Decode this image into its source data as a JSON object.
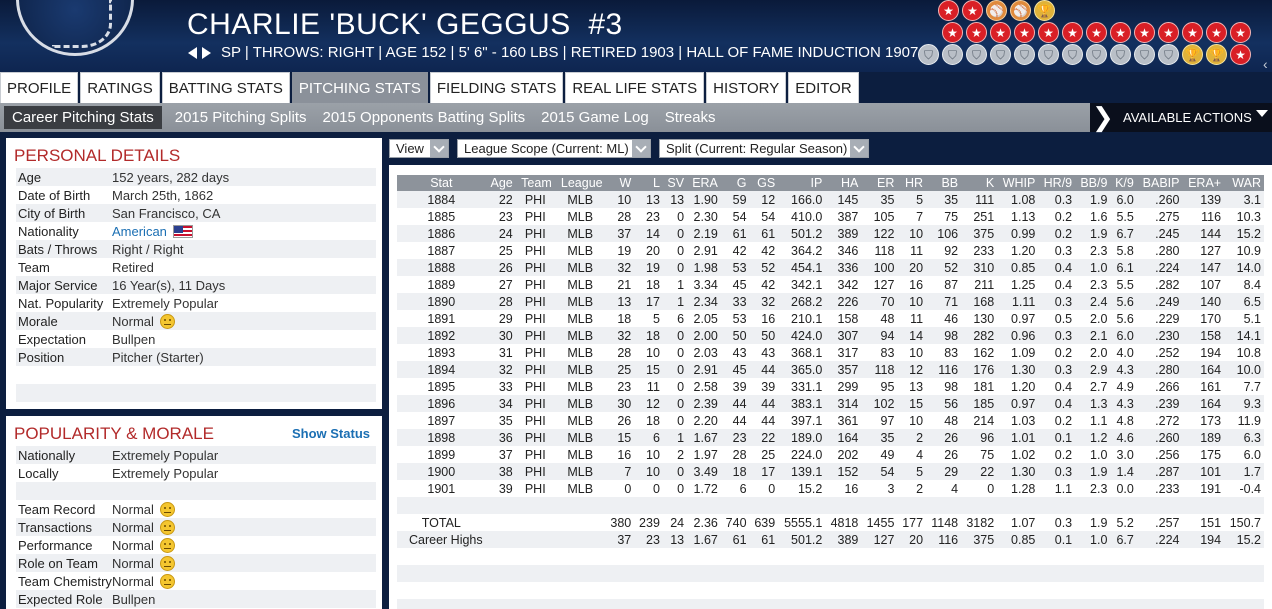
{
  "header": {
    "name": "CHARLIE 'BUCK' GEGGUS",
    "number": "#3",
    "info": "SP | THROWS: RIGHT  |  AGE 152  |  5' 6\" - 160 LBS  |  RETIRED 1903  |  HALL OF FAME INDUCTION 1907  |",
    "awards_row1": [
      "star",
      "star",
      "ball",
      "ball",
      "gold"
    ],
    "awards_row2": [
      "star",
      "star",
      "star",
      "star",
      "star",
      "star",
      "star",
      "star",
      "star",
      "star",
      "star",
      "star",
      "star"
    ],
    "awards_row3": [
      "silver",
      "silver",
      "silver",
      "silver",
      "silver",
      "silver",
      "silver",
      "silver",
      "silver",
      "silver",
      "silver",
      "gold",
      "gold",
      "star"
    ]
  },
  "tabs": [
    "PROFILE",
    "RATINGS",
    "BATTING STATS",
    "PITCHING STATS",
    "FIELDING STATS",
    "REAL LIFE STATS",
    "HISTORY",
    "EDITOR"
  ],
  "active_tab": "PITCHING STATS",
  "subtabs": [
    "Career Pitching Stats",
    "2015 Pitching Splits",
    "2015 Opponents Batting Splits",
    "2015 Game Log",
    "Streaks"
  ],
  "actions_label": "AVAILABLE ACTIONS",
  "personal": {
    "title": "PERSONAL DETAILS",
    "rows": [
      {
        "k": "Age",
        "v": "152 years, 282 days"
      },
      {
        "k": "Date of Birth",
        "v": "March 25th, 1862"
      },
      {
        "k": "City of Birth",
        "v": "San Francisco, CA"
      },
      {
        "k": "Nationality",
        "v": "American"
      },
      {
        "k": "Bats / Throws",
        "v": "Right / Right"
      },
      {
        "k": "Team",
        "v": "Retired"
      },
      {
        "k": "Major Service",
        "v": "16 Year(s), 11 Days"
      },
      {
        "k": "Nat. Popularity",
        "v": "Extremely Popular"
      },
      {
        "k": "Morale",
        "v": "Normal"
      },
      {
        "k": "Expectation",
        "v": "Bullpen"
      },
      {
        "k": "Position",
        "v": "Pitcher (Starter)"
      }
    ]
  },
  "popularity": {
    "title": "POPULARITY & MORALE",
    "show_status": "Show Status",
    "rows": [
      {
        "k": "Nationally",
        "v": "Extremely Popular"
      },
      {
        "k": "Locally",
        "v": "Extremely Popular"
      },
      {
        "k": "",
        "v": ""
      },
      {
        "k": "Team Record",
        "v": "Normal"
      },
      {
        "k": "Transactions",
        "v": "Normal"
      },
      {
        "k": "Performance",
        "v": "Normal"
      },
      {
        "k": "Role on Team",
        "v": "Normal"
      },
      {
        "k": "Team Chemistry",
        "v": "Normal"
      },
      {
        "k": "Expected Role",
        "v": "Bullpen"
      }
    ]
  },
  "dropdowns": {
    "view": "View",
    "league_scope": "League Scope  (Current: ML)",
    "split": "Split  (Current: Regular Season)"
  },
  "stats": {
    "columns": [
      "Stat",
      "Age",
      "Team",
      "League",
      "W",
      "L",
      "SV",
      "ERA",
      "G",
      "GS",
      "IP",
      "HA",
      "ER",
      "HR",
      "BB",
      "K",
      "WHIP",
      "HR/9",
      "BB/9",
      "K/9",
      "BABIP",
      "ERA+",
      "WAR"
    ],
    "rows": [
      [
        "1884",
        "22",
        "PHI",
        "MLB",
        "10",
        "13",
        "13",
        "1.90",
        "59",
        "12",
        "166.0",
        "145",
        "35",
        "5",
        "35",
        "111",
        "1.08",
        "0.3",
        "1.9",
        "6.0",
        ".260",
        "139",
        "3.1"
      ],
      [
        "1885",
        "23",
        "PHI",
        "MLB",
        "28",
        "23",
        "0",
        "2.30",
        "54",
        "54",
        "410.0",
        "387",
        "105",
        "7",
        "75",
        "251",
        "1.13",
        "0.2",
        "1.6",
        "5.5",
        ".275",
        "116",
        "10.3"
      ],
      [
        "1886",
        "24",
        "PHI",
        "MLB",
        "37",
        "14",
        "0",
        "2.19",
        "61",
        "61",
        "501.2",
        "389",
        "122",
        "10",
        "106",
        "375",
        "0.99",
        "0.2",
        "1.9",
        "6.7",
        ".245",
        "144",
        "15.2"
      ],
      [
        "1887",
        "25",
        "PHI",
        "MLB",
        "19",
        "20",
        "0",
        "2.91",
        "42",
        "42",
        "364.2",
        "346",
        "118",
        "11",
        "92",
        "233",
        "1.20",
        "0.3",
        "2.3",
        "5.8",
        ".280",
        "127",
        "10.9"
      ],
      [
        "1888",
        "26",
        "PHI",
        "MLB",
        "32",
        "19",
        "0",
        "1.98",
        "53",
        "52",
        "454.1",
        "336",
        "100",
        "20",
        "52",
        "310",
        "0.85",
        "0.4",
        "1.0",
        "6.1",
        ".224",
        "147",
        "14.0"
      ],
      [
        "1889",
        "27",
        "PHI",
        "MLB",
        "21",
        "18",
        "1",
        "3.34",
        "45",
        "42",
        "342.1",
        "342",
        "127",
        "16",
        "87",
        "211",
        "1.25",
        "0.4",
        "2.3",
        "5.5",
        ".282",
        "107",
        "8.4"
      ],
      [
        "1890",
        "28",
        "PHI",
        "MLB",
        "13",
        "17",
        "1",
        "2.34",
        "33",
        "32",
        "268.2",
        "226",
        "70",
        "10",
        "71",
        "168",
        "1.11",
        "0.3",
        "2.4",
        "5.6",
        ".249",
        "140",
        "6.5"
      ],
      [
        "1891",
        "29",
        "PHI",
        "MLB",
        "18",
        "5",
        "6",
        "2.05",
        "53",
        "16",
        "210.1",
        "158",
        "48",
        "11",
        "46",
        "130",
        "0.97",
        "0.5",
        "2.0",
        "5.6",
        ".229",
        "170",
        "5.1"
      ],
      [
        "1892",
        "30",
        "PHI",
        "MLB",
        "32",
        "18",
        "0",
        "2.00",
        "50",
        "50",
        "424.0",
        "307",
        "94",
        "14",
        "98",
        "282",
        "0.96",
        "0.3",
        "2.1",
        "6.0",
        ".230",
        "158",
        "14.1"
      ],
      [
        "1893",
        "31",
        "PHI",
        "MLB",
        "28",
        "10",
        "0",
        "2.03",
        "43",
        "43",
        "368.1",
        "317",
        "83",
        "10",
        "83",
        "162",
        "1.09",
        "0.2",
        "2.0",
        "4.0",
        ".252",
        "194",
        "10.8"
      ],
      [
        "1894",
        "32",
        "PHI",
        "MLB",
        "25",
        "15",
        "0",
        "2.91",
        "45",
        "44",
        "365.0",
        "357",
        "118",
        "12",
        "116",
        "176",
        "1.30",
        "0.3",
        "2.9",
        "4.3",
        ".280",
        "164",
        "10.0"
      ],
      [
        "1895",
        "33",
        "PHI",
        "MLB",
        "23",
        "11",
        "0",
        "2.58",
        "39",
        "39",
        "331.1",
        "299",
        "95",
        "13",
        "98",
        "181",
        "1.20",
        "0.4",
        "2.7",
        "4.9",
        ".266",
        "161",
        "7.7"
      ],
      [
        "1896",
        "34",
        "PHI",
        "MLB",
        "30",
        "12",
        "0",
        "2.39",
        "44",
        "44",
        "383.1",
        "314",
        "102",
        "15",
        "56",
        "185",
        "0.97",
        "0.4",
        "1.3",
        "4.3",
        ".239",
        "164",
        "9.3"
      ],
      [
        "1897",
        "35",
        "PHI",
        "MLB",
        "26",
        "18",
        "0",
        "2.20",
        "44",
        "44",
        "397.1",
        "361",
        "97",
        "10",
        "48",
        "214",
        "1.03",
        "0.2",
        "1.1",
        "4.8",
        ".272",
        "173",
        "11.9"
      ],
      [
        "1898",
        "36",
        "PHI",
        "MLB",
        "15",
        "6",
        "1",
        "1.67",
        "23",
        "22",
        "189.0",
        "164",
        "35",
        "2",
        "26",
        "96",
        "1.01",
        "0.1",
        "1.2",
        "4.6",
        ".260",
        "189",
        "6.3"
      ],
      [
        "1899",
        "37",
        "PHI",
        "MLB",
        "16",
        "10",
        "2",
        "1.97",
        "28",
        "25",
        "224.0",
        "202",
        "49",
        "4",
        "26",
        "75",
        "1.02",
        "0.2",
        "1.0",
        "3.0",
        ".256",
        "175",
        "6.0"
      ],
      [
        "1900",
        "38",
        "PHI",
        "MLB",
        "7",
        "10",
        "0",
        "3.49",
        "18",
        "17",
        "139.1",
        "152",
        "54",
        "5",
        "29",
        "22",
        "1.30",
        "0.3",
        "1.9",
        "1.4",
        ".287",
        "101",
        "1.7"
      ],
      [
        "1901",
        "39",
        "PHI",
        "MLB",
        "0",
        "0",
        "0",
        "1.72",
        "6",
        "0",
        "15.2",
        "16",
        "3",
        "2",
        "4",
        "0",
        "1.28",
        "1.1",
        "2.3",
        "0.0",
        ".233",
        "191",
        "-0.4"
      ]
    ],
    "total": [
      "TOTAL",
      "",
      "",
      "",
      "380",
      "239",
      "24",
      "2.36",
      "740",
      "639",
      "5555.1",
      "4818",
      "1455",
      "177",
      "1148",
      "3182",
      "1.07",
      "0.3",
      "1.9",
      "5.2",
      ".257",
      "151",
      "150.7"
    ],
    "career_highs": [
      "Career Highs",
      "",
      "",
      "",
      "37",
      "23",
      "13",
      "1.67",
      "61",
      "61",
      "501.2",
      "389",
      "127",
      "20",
      "116",
      "375",
      "0.85",
      "0.1",
      "1.0",
      "6.7",
      ".224",
      "194",
      "15.2"
    ]
  }
}
